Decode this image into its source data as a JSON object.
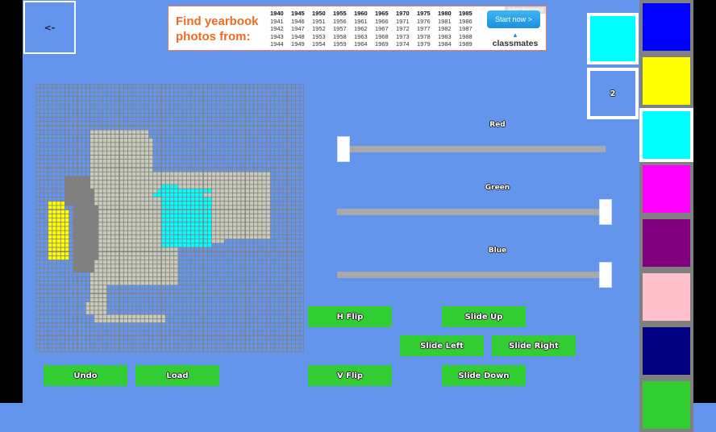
{
  "nav": {
    "back_label": "<-"
  },
  "ad": {
    "headline": "Find yearbook photos from:",
    "label": "Advertisement",
    "cta": "Start now >",
    "brand": "classmates",
    "years": [
      [
        "1940",
        "1945",
        "1950",
        "1955",
        "1960",
        "1965",
        "1970",
        "1975",
        "1980",
        "1985"
      ],
      [
        "1941",
        "1946",
        "1951",
        "1956",
        "1961",
        "1966",
        "1971",
        "1976",
        "1981",
        "1986"
      ],
      [
        "1942",
        "1947",
        "1952",
        "1957",
        "1962",
        "1967",
        "1972",
        "1977",
        "1982",
        "1987"
      ],
      [
        "1943",
        "1948",
        "1953",
        "1958",
        "1963",
        "1968",
        "1973",
        "1978",
        "1983",
        "1988"
      ],
      [
        "1944",
        "1949",
        "1954",
        "1959",
        "1964",
        "1969",
        "1974",
        "1979",
        "1984",
        "1989"
      ]
    ]
  },
  "canvas": {
    "grid_cells": 64,
    "major_every": 10,
    "background": "#6495ed",
    "grid_color": "#808080",
    "regions": [
      {
        "color": "#c8cbba",
        "col": 13,
        "row": 11,
        "w": 14,
        "h": 2
      },
      {
        "color": "#c8cbba",
        "col": 13,
        "row": 13,
        "w": 15,
        "h": 8
      },
      {
        "color": "#c8cbba",
        "col": 17,
        "row": 21,
        "w": 39,
        "h": 4
      },
      {
        "color": "#c8cbba",
        "col": 17,
        "row": 25,
        "w": 39,
        "h": 12
      },
      {
        "color": "#c8cbba",
        "col": 13,
        "row": 21,
        "w": 4,
        "h": 2
      },
      {
        "color": "#c8cbba",
        "col": 13,
        "row": 23,
        "w": 4,
        "h": 32
      },
      {
        "color": "#c8cbba",
        "col": 17,
        "row": 37,
        "w": 17,
        "h": 9
      },
      {
        "color": "#c8cbba",
        "col": 34,
        "row": 37,
        "w": 11,
        "h": 1
      },
      {
        "color": "#c8cbba",
        "col": 17,
        "row": 46,
        "w": 17,
        "h": 2
      },
      {
        "color": "#c8cbba",
        "col": 12,
        "row": 52,
        "w": 5,
        "h": 3
      },
      {
        "color": "#c8cbba",
        "col": 14,
        "row": 55,
        "w": 17,
        "h": 2
      },
      {
        "color": "#808080",
        "col": 7,
        "row": 22,
        "w": 6,
        "h": 3
      },
      {
        "color": "#808080",
        "col": 7,
        "row": 25,
        "w": 7,
        "h": 4
      },
      {
        "color": "#808080",
        "col": 9,
        "row": 29,
        "w": 6,
        "h": 13
      },
      {
        "color": "#808080",
        "col": 9,
        "row": 42,
        "w": 5,
        "h": 3
      },
      {
        "color": "#ffff00",
        "col": 3,
        "row": 28,
        "w": 4,
        "h": 2
      },
      {
        "color": "#ffff00",
        "col": 3,
        "row": 30,
        "w": 5,
        "h": 12
      },
      {
        "color": "#00ffff",
        "col": 30,
        "row": 25,
        "w": 12,
        "h": 1
      },
      {
        "color": "#00ffff",
        "col": 28,
        "row": 26,
        "w": 12,
        "h": 1
      },
      {
        "color": "#00ffff",
        "col": 29,
        "row": 25,
        "w": 4,
        "h": 1
      },
      {
        "color": "#00ffff",
        "col": 30,
        "row": 24,
        "w": 4,
        "h": 1
      },
      {
        "color": "#00ffff",
        "col": 30,
        "row": 27,
        "w": 12,
        "h": 1
      },
      {
        "color": "#00ffff",
        "col": 30,
        "row": 28,
        "w": 12,
        "h": 11
      }
    ]
  },
  "sliders": [
    {
      "name": "red",
      "label": "Red",
      "value": 0,
      "max": 255
    },
    {
      "name": "green",
      "label": "Green",
      "value": 255,
      "max": 255
    },
    {
      "name": "blue",
      "label": "Blue",
      "value": 255,
      "max": 255
    }
  ],
  "buttons": {
    "undo": "Undo",
    "load": "Load",
    "h_flip": "H Flip",
    "v_flip": "V Flip",
    "slide_up": "Slide Up",
    "slide_left": "Slide Left",
    "slide_right": "Slide Right",
    "slide_down": "Slide Down"
  },
  "current_color": "#00ffff",
  "brush_size": "2",
  "palette": [
    {
      "name": "blue",
      "color": "#0000ff",
      "selected": false
    },
    {
      "name": "yellow",
      "color": "#ffff00",
      "selected": false
    },
    {
      "name": "cyan",
      "color": "#00ffff",
      "selected": true
    },
    {
      "name": "magenta",
      "color": "#ff00ff",
      "selected": false
    },
    {
      "name": "purple",
      "color": "#800080",
      "selected": false
    },
    {
      "name": "pink",
      "color": "#ffc0cb",
      "selected": false
    },
    {
      "name": "navy",
      "color": "#000080",
      "selected": false
    },
    {
      "name": "green",
      "color": "#32cd32",
      "selected": false
    }
  ]
}
